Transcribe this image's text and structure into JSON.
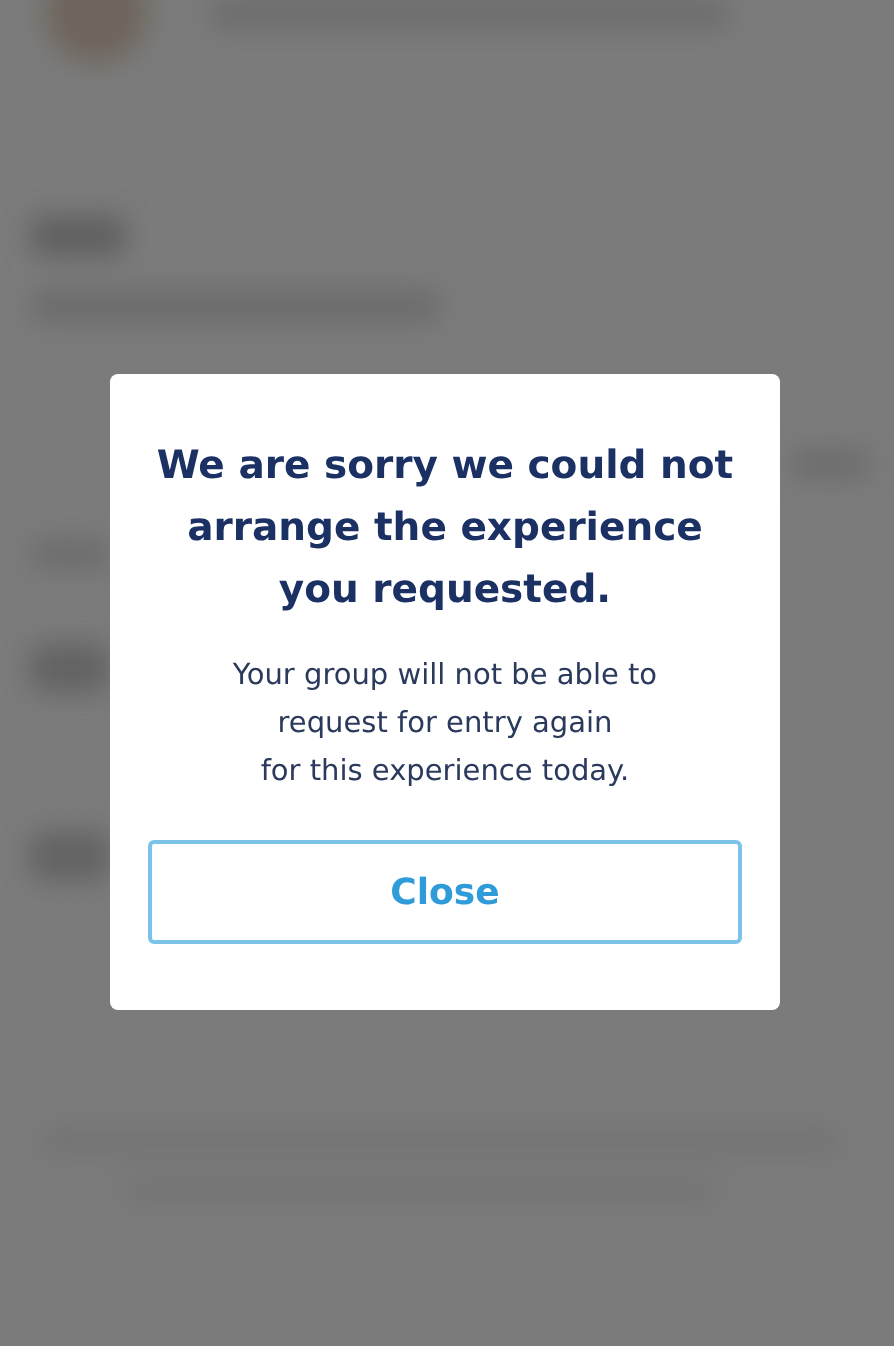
{
  "dialog": {
    "title": "We are sorry we could not\narrange the experience\nyou requested.",
    "message": "Your group will not be able to\nrequest for entry again\nfor this experience today.",
    "buttons": [
      "Close"
    ]
  }
}
